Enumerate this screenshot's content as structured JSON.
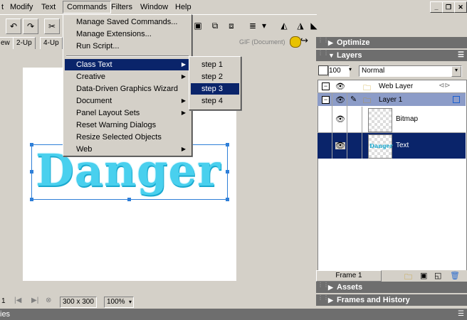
{
  "menubar": {
    "items": [
      "t",
      "Modify",
      "Text",
      "Commands",
      "Filters",
      "Window",
      "Help"
    ]
  },
  "view_tabs": [
    "ew",
    "2-Up",
    "4-Up"
  ],
  "toolbar": {
    "doc_label": "GIF (Document)"
  },
  "commands_menu": {
    "items": [
      {
        "label": "Manage Saved Commands...",
        "submenu": false
      },
      {
        "label": "Manage Extensions...",
        "submenu": false
      },
      {
        "label": "Run Script...",
        "submenu": false
      },
      {
        "label": "Class Text",
        "submenu": true,
        "highlighted": true
      },
      {
        "label": "Creative",
        "submenu": true
      },
      {
        "label": "Data-Driven Graphics Wizard",
        "submenu": false
      },
      {
        "label": "Document",
        "submenu": true
      },
      {
        "label": "Panel Layout Sets",
        "submenu": true
      },
      {
        "label": "Reset Warning Dialogs",
        "submenu": false
      },
      {
        "label": "Resize Selected Objects",
        "submenu": false
      },
      {
        "label": "Web",
        "submenu": true
      }
    ]
  },
  "class_text_submenu": {
    "items": [
      "step 1",
      "step 2",
      "step 3",
      "step 4"
    ],
    "highlighted": "step 3"
  },
  "canvas": {
    "text": "Danger"
  },
  "statusbar": {
    "frame": "1",
    "size": "300 x 300",
    "zoom": "100%"
  },
  "bottom_panel": {
    "label": "ies"
  },
  "panels": {
    "optimize": "Optimize",
    "layers": "Layers",
    "opacity": "100",
    "blend_mode": "Normal",
    "layer_rows": [
      {
        "name": "Web Layer",
        "type": "folder"
      },
      {
        "name": "Layer 1",
        "type": "folder"
      },
      {
        "name": "Bitmap",
        "type": "object"
      },
      {
        "name": "Text",
        "type": "object",
        "thumb_text": "Danger"
      }
    ],
    "frame_label": "Frame 1",
    "assets": "Assets",
    "frames_history": "Frames and History"
  },
  "colors": {
    "highlight": "#0a246a",
    "danger_text": "#49d0ee",
    "selection": "#2f7fd8"
  }
}
